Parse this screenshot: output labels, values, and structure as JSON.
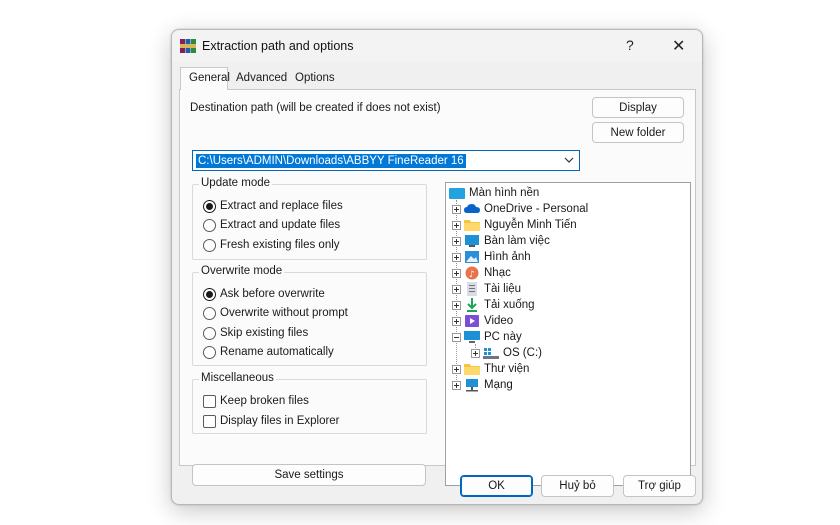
{
  "dialog": {
    "title": "Extraction path and options",
    "help_glyph": "?",
    "close_glyph": "✕"
  },
  "tabs": [
    {
      "label": "General",
      "active": true
    },
    {
      "label": "Advanced",
      "active": false
    },
    {
      "label": "Options",
      "active": false
    }
  ],
  "destination": {
    "label": "Destination path (will be created if does not exist)",
    "value": "C:\\Users\\ADMIN\\Downloads\\ABBYY FineReader 16"
  },
  "buttons": {
    "display": "Display",
    "new_folder": "New folder",
    "save_settings": "Save settings",
    "ok": "OK",
    "cancel": "Huỷ bỏ",
    "help": "Trợ giúp"
  },
  "update_mode": {
    "title": "Update mode",
    "options": [
      {
        "label": "Extract and replace files",
        "selected": true
      },
      {
        "label": "Extract and update files",
        "selected": false
      },
      {
        "label": "Fresh existing files only",
        "selected": false
      }
    ]
  },
  "overwrite_mode": {
    "title": "Overwrite mode",
    "options": [
      {
        "label": "Ask before overwrite",
        "selected": true
      },
      {
        "label": "Overwrite without prompt",
        "selected": false
      },
      {
        "label": "Skip existing files",
        "selected": false
      },
      {
        "label": "Rename automatically",
        "selected": false
      }
    ]
  },
  "miscellaneous": {
    "title": "Miscellaneous",
    "options": [
      {
        "label": "Keep broken files",
        "checked": false
      },
      {
        "label": "Display files in Explorer",
        "checked": false
      }
    ]
  },
  "tree": {
    "root": "Màn hình nền",
    "items": [
      {
        "label": "OneDrive - Personal",
        "icon": "cloud-icon"
      },
      {
        "label": "Nguyễn Minh Tiến",
        "icon": "user-folder-icon"
      },
      {
        "label": "Bàn làm việc",
        "icon": "desktop-icon"
      },
      {
        "label": "Hình ảnh",
        "icon": "pictures-icon"
      },
      {
        "label": "Nhạc",
        "icon": "music-icon"
      },
      {
        "label": "Tài liệu",
        "icon": "documents-icon"
      },
      {
        "label": "Tải xuống",
        "icon": "downloads-icon"
      },
      {
        "label": "Video",
        "icon": "videos-icon"
      },
      {
        "label": "PC này",
        "icon": "pc-icon"
      },
      {
        "label": "OS (C:)",
        "icon": "drive-icon"
      },
      {
        "label": "Thư viện",
        "icon": "library-icon"
      },
      {
        "label": "Mạng",
        "icon": "network-icon"
      }
    ]
  },
  "colors": {
    "accent": "#0067c0",
    "selection": "#0078d7"
  }
}
